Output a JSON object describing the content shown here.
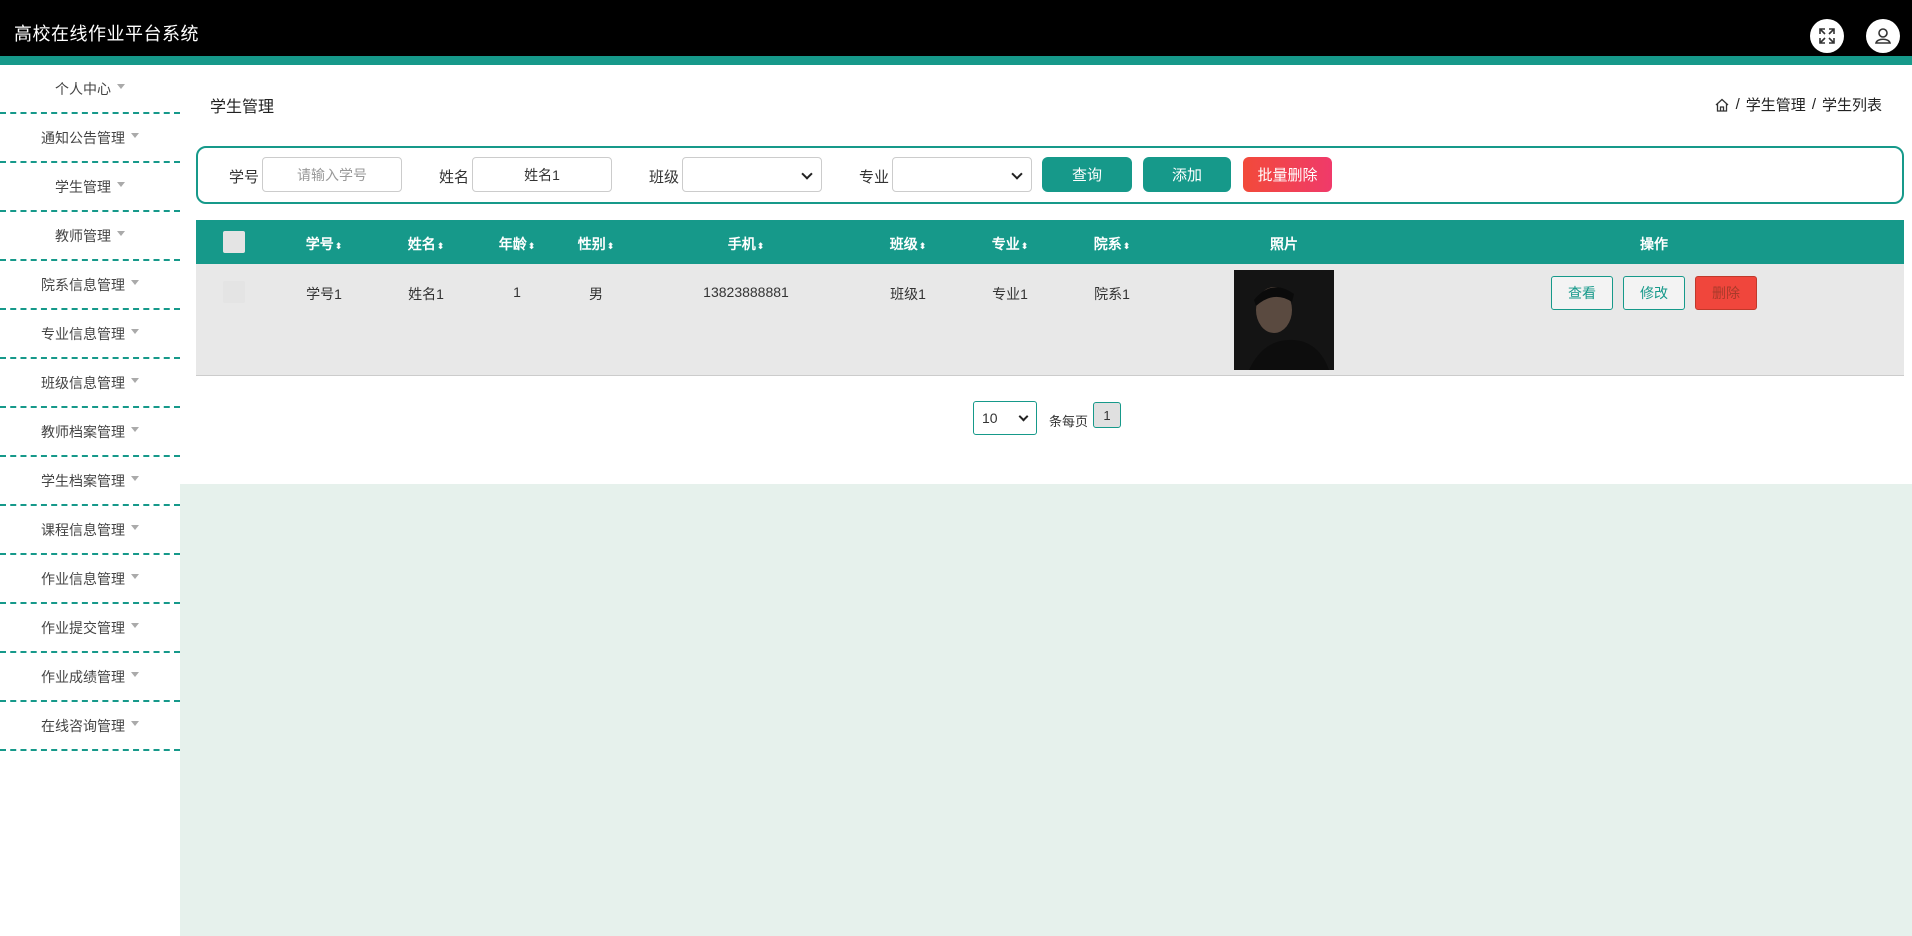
{
  "app": {
    "title": "高校在线作业平台系统"
  },
  "header_icons": [
    "fullscreen-icon",
    "user-icon"
  ],
  "sidebar": {
    "items": [
      {
        "label": "个人中心"
      },
      {
        "label": "通知公告管理"
      },
      {
        "label": "学生管理"
      },
      {
        "label": "教师管理"
      },
      {
        "label": "院系信息管理"
      },
      {
        "label": "专业信息管理"
      },
      {
        "label": "班级信息管理"
      },
      {
        "label": "教师档案管理"
      },
      {
        "label": "学生档案管理"
      },
      {
        "label": "课程信息管理"
      },
      {
        "label": "作业信息管理"
      },
      {
        "label": "作业提交管理"
      },
      {
        "label": "作业成绩管理"
      },
      {
        "label": "在线咨询管理"
      }
    ]
  },
  "page": {
    "title": "学生管理",
    "breadcrumb": {
      "home_icon": "home-icon",
      "sep": "/",
      "level1": "学生管理",
      "level2": "学生列表"
    }
  },
  "search": {
    "student_no_label": "学号",
    "student_no_placeholder": "请输入学号",
    "name_label": "姓名",
    "name_value": "姓名1",
    "class_label": "班级",
    "class_value": "",
    "major_label": "专业",
    "major_value": "",
    "query_button": "查询",
    "add_button": "添加",
    "batch_delete_button": "批量删除"
  },
  "table": {
    "headers": {
      "student_no": "学号",
      "name": "姓名",
      "age": "年龄",
      "gender": "性别",
      "phone": "手机",
      "class": "班级",
      "major": "专业",
      "department": "院系",
      "photo": "照片",
      "actions": "操作"
    },
    "sort_glyph": "⬍",
    "rows": [
      {
        "student_no": "学号1",
        "name": "姓名1",
        "age": "1",
        "gender": "男",
        "phone": "13823888881",
        "class": "班级1",
        "major": "专业1",
        "department": "院系1",
        "view_button": "查看",
        "edit_button": "修改",
        "delete_button": "删除"
      }
    ]
  },
  "pagination": {
    "page_size": "10",
    "per_page_text": "条每页",
    "current_page": "1"
  },
  "colors": {
    "primary": "#16998a",
    "topbar": "#000000",
    "danger": "#f24a3a",
    "main_bg": "#e6f1ec"
  }
}
